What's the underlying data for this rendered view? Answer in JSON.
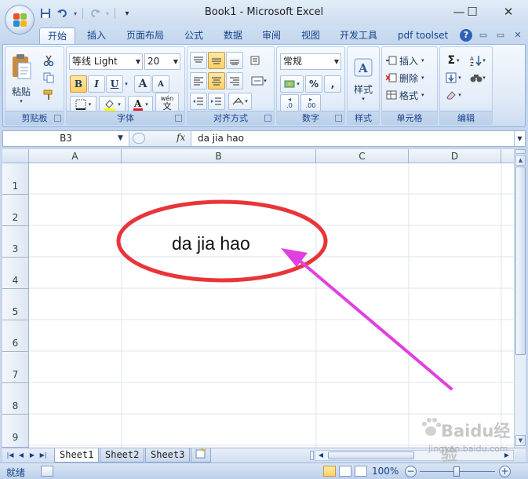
{
  "window": {
    "title": "Book1 - Microsoft Excel",
    "minimize_glyph": "—",
    "maximize_glyph": "☐",
    "close_glyph": "✕"
  },
  "qat": {
    "customize_glyph": "▾"
  },
  "ribbon_tabs": [
    "开始",
    "插入",
    "页面布局",
    "公式",
    "数据",
    "审阅",
    "视图",
    "开发工具",
    "pdf toolset"
  ],
  "ribbon_controls": {
    "help": "?",
    "min": "▭",
    "close": "✕"
  },
  "groups": {
    "clipboard": {
      "label": "剪贴板",
      "paste": "粘贴"
    },
    "font": {
      "label": "字体",
      "font_name": "等线 Light",
      "font_size": "20",
      "bold": "B",
      "italic": "I",
      "underline": "U",
      "grow": "A",
      "shrink": "A",
      "phonetic": "wén"
    },
    "alignment": {
      "label": "对齐方式"
    },
    "number": {
      "label": "数字",
      "format": "常规",
      "percent": "%",
      "comma": ",",
      "inc_decimal": ".0",
      "dec_decimal": ".00"
    },
    "styles": {
      "label": "样式",
      "button": "样式"
    },
    "cells": {
      "label": "单元格",
      "insert": "插入",
      "delete": "删除",
      "format": "格式"
    },
    "editing": {
      "label": "编辑",
      "sum": "Σ"
    }
  },
  "formula_bar": {
    "name_box": "B3",
    "fx": "fx",
    "content": "da jia hao"
  },
  "grid": {
    "columns": [
      "A",
      "B",
      "C",
      "D"
    ],
    "rows": [
      "1",
      "2",
      "3",
      "4",
      "5",
      "6",
      "7",
      "8",
      "9"
    ],
    "cell_B3": "da jia hao"
  },
  "sheets": [
    "Sheet1",
    "Sheet2",
    "Sheet3"
  ],
  "status": {
    "ready": "就绪",
    "zoom": "100%",
    "zoom_out": "−",
    "zoom_in": "+"
  },
  "watermark": {
    "brand": "Baidu经验",
    "url": "jingyan.baidu.com"
  },
  "annotation": {
    "ellipse_color": "#e8353a",
    "arrow_color": "#e040e0"
  }
}
